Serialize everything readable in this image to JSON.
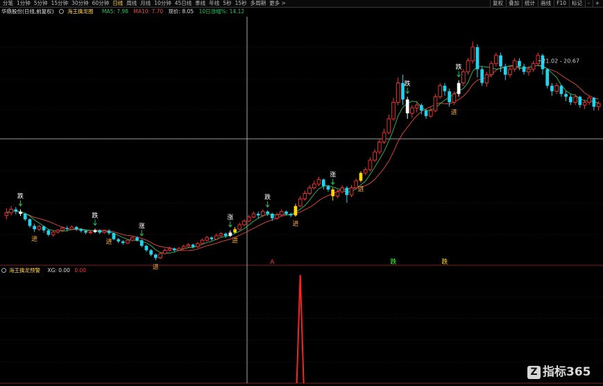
{
  "toolbar": {
    "left_tabs": [
      "分笔",
      "1分钟",
      "5分钟",
      "15分钟",
      "30分钟",
      "60分钟",
      "日线",
      "周线",
      "月线",
      "10分钟",
      "45日线",
      "季线",
      "年线",
      "5秒",
      "15秒",
      "多周期",
      "更多 >"
    ],
    "active_tab": 6,
    "right_tabs": [
      "复权",
      "叠加",
      "统计",
      "画线",
      "F10",
      "标记",
      "-",
      "+"
    ]
  },
  "info": {
    "title": "华鼎股份(日线,前复权)",
    "indicator": "海王擒龙图",
    "ma5": "MA5: 7.98",
    "ma10": "MA10: 7.70",
    "price": "现价: 8.05",
    "pct": "10日涨幅%: 14.12"
  },
  "sub_info": {
    "indicator": "海王擒龙预警",
    "xg": "XG: 0.00",
    "val": "0.00"
  },
  "chart_data": {
    "type": "candlestick",
    "price_range": [
      5.9,
      9.9
    ],
    "candles": [
      [
        6.55,
        6.6,
        6.68,
        6.48
      ],
      [
        6.6,
        6.66,
        6.72,
        6.55
      ],
      [
        6.66,
        6.62,
        6.7,
        6.57
      ],
      [
        6.62,
        6.58,
        6.66,
        6.54
      ],
      [
        6.58,
        6.48,
        6.6,
        6.45
      ],
      [
        6.48,
        6.36,
        6.5,
        6.33
      ],
      [
        6.36,
        6.3,
        6.4,
        6.25
      ],
      [
        6.3,
        6.35,
        6.38,
        6.27
      ],
      [
        6.35,
        6.28,
        6.37,
        6.24
      ],
      [
        6.28,
        6.2,
        6.3,
        6.17
      ],
      [
        6.2,
        6.25,
        6.28,
        6.17
      ],
      [
        6.25,
        6.28,
        6.3,
        6.22
      ],
      [
        6.28,
        6.32,
        6.35,
        6.25
      ],
      [
        6.32,
        6.3,
        6.36,
        6.27
      ],
      [
        6.3,
        6.34,
        6.37,
        6.28
      ],
      [
        6.34,
        6.3,
        6.36,
        6.27
      ],
      [
        6.3,
        6.27,
        6.32,
        6.24
      ],
      [
        6.27,
        6.24,
        6.29,
        6.21
      ],
      [
        6.24,
        6.25,
        6.28,
        6.21
      ],
      [
        6.25,
        6.28,
        6.31,
        6.23
      ],
      [
        6.28,
        6.24,
        6.3,
        6.21
      ],
      [
        6.24,
        6.27,
        6.29,
        6.22
      ],
      [
        6.27,
        6.23,
        6.3,
        6.2
      ],
      [
        6.23,
        6.12,
        6.24,
        6.1
      ],
      [
        6.12,
        6.08,
        6.14,
        6.05
      ],
      [
        6.08,
        6.05,
        6.1,
        6.02
      ],
      [
        6.05,
        6.1,
        6.12,
        6.03
      ],
      [
        6.1,
        6.15,
        6.18,
        6.08
      ],
      [
        6.15,
        6.1,
        6.17,
        6.08
      ],
      [
        6.1,
        6.0,
        6.12,
        5.97
      ],
      [
        6.0,
        5.92,
        6.02,
        5.89
      ],
      [
        5.92,
        5.84,
        5.94,
        5.81
      ],
      [
        5.84,
        5.78,
        5.86,
        5.74
      ],
      [
        5.78,
        5.86,
        5.88,
        5.76
      ],
      [
        5.86,
        5.92,
        5.95,
        5.84
      ],
      [
        5.92,
        5.95,
        5.98,
        5.9
      ],
      [
        5.95,
        5.92,
        5.97,
        5.89
      ],
      [
        5.92,
        5.95,
        5.98,
        5.9
      ],
      [
        5.95,
        5.99,
        6.02,
        5.93
      ],
      [
        5.99,
        6.02,
        6.05,
        5.97
      ],
      [
        6.02,
        5.98,
        6.04,
        5.95
      ],
      [
        5.98,
        6.04,
        6.07,
        5.96
      ],
      [
        6.04,
        6.1,
        6.13,
        6.02
      ],
      [
        6.1,
        6.15,
        6.18,
        6.08
      ],
      [
        6.15,
        6.12,
        6.17,
        6.09
      ],
      [
        6.12,
        6.18,
        6.22,
        6.1
      ],
      [
        6.18,
        6.22,
        6.25,
        6.15
      ],
      [
        6.22,
        6.18,
        6.24,
        6.14
      ],
      [
        6.18,
        6.24,
        6.28,
        6.16
      ],
      [
        6.24,
        6.3,
        6.34,
        6.22
      ],
      [
        6.3,
        6.38,
        6.42,
        6.28
      ],
      [
        6.38,
        6.45,
        6.48,
        6.35
      ],
      [
        6.45,
        6.52,
        6.56,
        6.43
      ],
      [
        6.52,
        6.58,
        6.62,
        6.5
      ],
      [
        6.58,
        6.55,
        6.62,
        6.5
      ],
      [
        6.55,
        6.62,
        6.66,
        6.52
      ],
      [
        6.62,
        6.58,
        6.64,
        6.54
      ],
      [
        6.58,
        6.5,
        6.6,
        6.45
      ],
      [
        6.5,
        6.56,
        6.6,
        6.47
      ],
      [
        6.56,
        6.62,
        6.66,
        6.54
      ],
      [
        6.62,
        6.58,
        6.64,
        6.55
      ],
      [
        6.58,
        6.55,
        6.6,
        6.52
      ],
      [
        6.55,
        6.72,
        6.76,
        6.53
      ],
      [
        6.72,
        6.85,
        6.9,
        6.7
      ],
      [
        6.85,
        6.95,
        7.0,
        6.82
      ],
      [
        6.95,
        7.05,
        7.1,
        6.92
      ],
      [
        7.05,
        7.12,
        7.18,
        7.02
      ],
      [
        7.12,
        7.2,
        7.25,
        7.08
      ],
      [
        7.2,
        7.08,
        7.22,
        7.02
      ],
      [
        7.08,
        7.02,
        7.1,
        6.98
      ],
      [
        7.02,
        6.9,
        7.05,
        6.82
      ],
      [
        6.9,
        6.98,
        7.02,
        6.86
      ],
      [
        6.98,
        7.05,
        7.1,
        6.95
      ],
      [
        7.05,
        6.92,
        7.08,
        6.78
      ],
      [
        6.92,
        7.05,
        7.1,
        6.88
      ],
      [
        7.05,
        7.18,
        7.22,
        7.02
      ],
      [
        7.18,
        7.32,
        7.35,
        7.15
      ],
      [
        7.32,
        7.38,
        7.42,
        7.28
      ],
      [
        7.38,
        7.55,
        7.6,
        7.35
      ],
      [
        7.55,
        7.7,
        7.75,
        7.52
      ],
      [
        7.7,
        7.88,
        7.93,
        7.66
      ],
      [
        7.88,
        8.05,
        8.12,
        7.85
      ],
      [
        8.05,
        8.3,
        8.38,
        8.02
      ],
      [
        8.3,
        8.6,
        8.68,
        8.26
      ],
      [
        8.6,
        8.95,
        9.05,
        8.55
      ],
      [
        8.95,
        8.65,
        9.1,
        8.55
      ],
      [
        8.65,
        8.4,
        8.7,
        8.3
      ],
      [
        8.4,
        8.5,
        8.55,
        8.32
      ],
      [
        8.5,
        8.55,
        8.6,
        8.42
      ],
      [
        8.55,
        8.45,
        8.58,
        8.38
      ],
      [
        8.45,
        8.35,
        8.48,
        8.3
      ],
      [
        8.35,
        8.45,
        8.5,
        8.32
      ],
      [
        8.45,
        8.7,
        8.75,
        8.42
      ],
      [
        8.7,
        8.9,
        8.95,
        8.66
      ],
      [
        8.9,
        8.8,
        8.95,
        8.72
      ],
      [
        8.8,
        8.6,
        8.85,
        8.52
      ],
      [
        8.6,
        8.75,
        8.8,
        8.55
      ],
      [
        8.75,
        8.95,
        9.0,
        8.7
      ],
      [
        8.95,
        9.15,
        9.2,
        8.9
      ],
      [
        9.15,
        9.35,
        9.4,
        9.1
      ],
      [
        9.35,
        9.6,
        9.7,
        9.3
      ],
      [
        9.6,
        9.2,
        9.65,
        9.05
      ],
      [
        9.2,
        8.95,
        9.25,
        8.9
      ],
      [
        8.95,
        9.1,
        9.15,
        8.88
      ],
      [
        9.1,
        9.3,
        9.35,
        9.05
      ],
      [
        9.3,
        9.45,
        9.5,
        9.25
      ],
      [
        9.45,
        9.25,
        9.5,
        9.15
      ],
      [
        9.25,
        9.1,
        9.3,
        9.0
      ],
      [
        9.1,
        9.2,
        9.25,
        9.05
      ],
      [
        9.2,
        9.35,
        9.4,
        9.15
      ],
      [
        9.35,
        9.25,
        9.4,
        9.18
      ],
      [
        9.25,
        9.15,
        9.3,
        9.1
      ],
      [
        9.15,
        9.2,
        9.25,
        9.08
      ],
      [
        9.2,
        9.3,
        9.35,
        9.15
      ],
      [
        9.3,
        9.45,
        9.5,
        9.25
      ],
      [
        9.45,
        9.2,
        9.48,
        9.1
      ],
      [
        9.2,
        8.9,
        9.22,
        8.85
      ],
      [
        8.9,
        8.8,
        8.95,
        8.72
      ],
      [
        8.8,
        8.9,
        8.95,
        8.75
      ],
      [
        8.9,
        8.75,
        8.92,
        8.7
      ],
      [
        8.75,
        8.7,
        8.8,
        8.62
      ],
      [
        8.7,
        8.6,
        8.75,
        8.55
      ],
      [
        8.6,
        8.7,
        8.75,
        8.55
      ],
      [
        8.7,
        8.55,
        8.72,
        8.5
      ],
      [
        8.55,
        8.6,
        8.65,
        8.48
      ],
      [
        8.6,
        8.68,
        8.72,
        8.55
      ],
      [
        8.68,
        8.52,
        8.7,
        8.45
      ],
      [
        8.52,
        8.58,
        8.62,
        8.45
      ]
    ],
    "markers": [
      {
        "index": 3,
        "label": "跌",
        "kind": "sell"
      },
      {
        "index": 6,
        "label": "进",
        "kind": "buy"
      },
      {
        "index": 19,
        "label": "跌",
        "kind": "sell"
      },
      {
        "index": 22,
        "label": "进",
        "kind": "buy"
      },
      {
        "index": 29,
        "label": "涨",
        "kind": "sell"
      },
      {
        "index": 32,
        "label": "进",
        "kind": "buy"
      },
      {
        "index": 48,
        "label": "涨",
        "kind": "sell"
      },
      {
        "index": 49,
        "label": "进",
        "kind": "buy"
      },
      {
        "index": 56,
        "label": "跌",
        "kind": "sell"
      },
      {
        "index": 62,
        "label": "进",
        "kind": "buy"
      },
      {
        "index": 70,
        "label": "涨",
        "kind": "sell"
      },
      {
        "index": 76,
        "label": "进",
        "kind": "buy"
      },
      {
        "index": 86,
        "label": "跌",
        "kind": "sell"
      },
      {
        "index": 96,
        "label": "进",
        "kind": "buy"
      },
      {
        "index": 97,
        "label": "跌",
        "kind": "sell"
      }
    ],
    "price_annotation": "21.02 - 20.67",
    "bottom_labels": [
      {
        "index": 57,
        "label": "A",
        "color": "#ff3030"
      },
      {
        "index": 83,
        "label": "跌",
        "color": "#33ff33"
      },
      {
        "index": 94,
        "label": "跌",
        "color": "#ffd700"
      }
    ],
    "sub_values": [
      {
        "index": 63,
        "value": 1.0
      }
    ],
    "sub_range": [
      0,
      1.0
    ]
  },
  "colors": {
    "up": "#ff3030",
    "down": "#22d3ee",
    "ma5": "#22c55e",
    "ma10": "#ef4444",
    "highlight_yellow": "#ffd700",
    "highlight_white": "#ffffff"
  },
  "watermark": {
    "text": "指标365",
    "logo": "Z"
  }
}
